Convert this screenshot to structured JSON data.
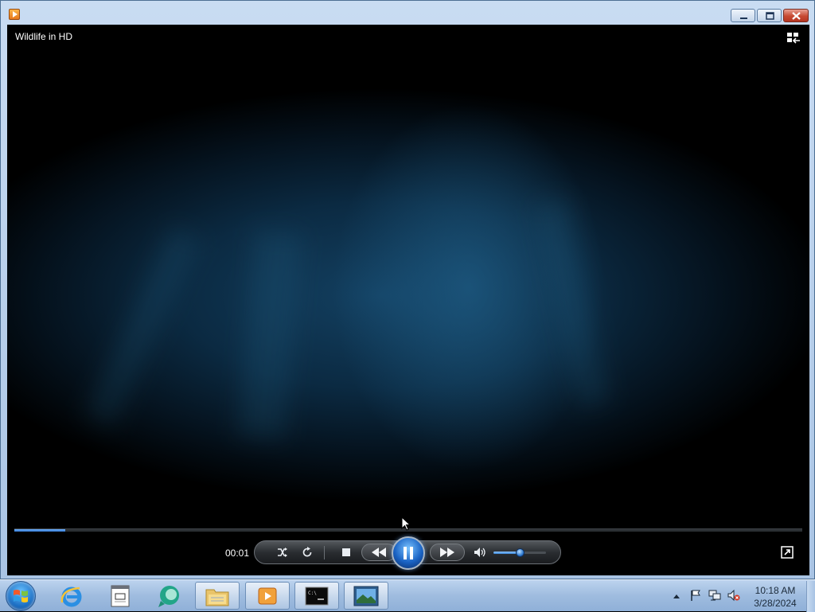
{
  "window": {
    "app_icon": "media-player-icon",
    "controls": [
      "minimize-icon",
      "maximize-icon",
      "close-icon"
    ]
  },
  "player": {
    "title": "Wildlife in HD",
    "elapsed": "00:01",
    "progress": 0.065,
    "volume": 0.5,
    "state": "playing",
    "accent_color": "#2f73c9"
  },
  "controls": [
    "shuffle-icon",
    "repeat-icon",
    "stop-icon",
    "previous-icon",
    "pause-icon",
    "next-icon",
    "volume-icon"
  ],
  "taskbar": {
    "apps": [
      "internet-explorer-icon",
      "notepad-icon",
      "app-icon",
      "file-explorer-icon",
      "media-player-icon",
      "command-prompt-icon",
      "image-viewer-icon"
    ],
    "tray_icons": [
      "action-center-flag-icon",
      "network-icon",
      "volume-muted-icon"
    ],
    "clock": {
      "time": "10:18 AM",
      "date": "3/28/2024"
    }
  }
}
